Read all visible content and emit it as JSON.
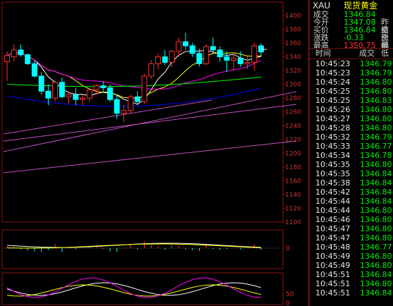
{
  "quote": {
    "symbol": "XAU",
    "name": "现货黄金",
    "rows": [
      {
        "label": "成交",
        "value": "1346.84",
        "color": "#00ee00",
        "extra": ""
      },
      {
        "label": "今开",
        "value": "1347.08",
        "color": "#00ee00",
        "extra": "昨结"
      },
      {
        "label": "买价",
        "value": "1346.84",
        "color": "#00ee00",
        "extra": "卖价"
      },
      {
        "label": "涨跌",
        "value": "-0.33",
        "color": "#00ee00",
        "extra": "涨幅"
      },
      {
        "label": "最高",
        "value": "1350.75",
        "color": "#ff3030",
        "extra": "最低"
      }
    ]
  },
  "ticks": {
    "time_header": "时间",
    "price_header": "成交",
    "rows": [
      {
        "time": "10:45:23",
        "price": "1346.79"
      },
      {
        "time": "10:45:23",
        "price": "1346.79"
      },
      {
        "time": "10:45:24",
        "price": "1346.80"
      },
      {
        "time": "10:45:25",
        "price": "1346.80"
      },
      {
        "time": "10:45:25",
        "price": "1346.83"
      },
      {
        "time": "10:45:26",
        "price": "1346.80"
      },
      {
        "time": "10:45:27",
        "price": "1346.80"
      },
      {
        "time": "10:45:28",
        "price": "1346.80"
      },
      {
        "time": "10:45:32",
        "price": "1346.79"
      },
      {
        "time": "10:45:33",
        "price": "1346.77"
      },
      {
        "time": "10:45:34",
        "price": "1346.78"
      },
      {
        "time": "10:45:35",
        "price": "1346.80"
      },
      {
        "time": "10:45:35",
        "price": "1346.84"
      },
      {
        "time": "10:45:38",
        "price": "1346.84"
      },
      {
        "time": "10:45:42",
        "price": "1346.84"
      },
      {
        "time": "10:45:44",
        "price": "1346.84"
      },
      {
        "time": "10:45:44",
        "price": "1346.80"
      },
      {
        "time": "10:45:46",
        "price": "1346.80"
      },
      {
        "time": "10:45:47",
        "price": "1346.80"
      },
      {
        "time": "10:45:47",
        "price": "1346.80"
      },
      {
        "time": "10:45:48",
        "price": "1346.77"
      },
      {
        "time": "10:45:49",
        "price": "1346.80"
      },
      {
        "time": "10:45:49",
        "price": "1346.80"
      },
      {
        "time": "10:45:51",
        "price": "1346.84"
      },
      {
        "time": "10:45:51",
        "price": "1346.80"
      },
      {
        "time": "10:45:51",
        "price": "1346.84"
      }
    ]
  },
  "price_axis": {
    "labels": [
      "1400",
      "1380",
      "1360",
      "1340",
      "1320",
      "1300",
      "1280",
      "1260",
      "1240",
      "1220",
      "1200",
      "1180",
      "1160",
      "1140",
      "1120",
      "1100"
    ],
    "min": 1100,
    "max": 1400
  },
  "indicator1_axis": {
    "zero_label": "0"
  },
  "indicator2_axis": {
    "labels": [
      "50",
      "0"
    ]
  },
  "colors": {
    "up": "#ff3030",
    "down": "#00ffff",
    "grid_frame": "#8a1515",
    "ma5": "#ffffff",
    "ma10": "#ffff00",
    "ma20": "#ff00ff",
    "ma60": "#00ff00",
    "ma120": "#0000ff",
    "trendline": "#c050c0"
  },
  "chart_data": {
    "type": "candlestick",
    "y_min": 1100,
    "y_max": 1400,
    "candles": [
      {
        "o": 1333,
        "h": 1348,
        "l": 1305,
        "c": 1342
      },
      {
        "o": 1340,
        "h": 1358,
        "l": 1333,
        "c": 1350
      },
      {
        "o": 1350,
        "h": 1358,
        "l": 1340,
        "c": 1343
      },
      {
        "o": 1343,
        "h": 1345,
        "l": 1328,
        "c": 1330
      },
      {
        "o": 1330,
        "h": 1335,
        "l": 1310,
        "c": 1312
      },
      {
        "o": 1312,
        "h": 1318,
        "l": 1285,
        "c": 1290
      },
      {
        "o": 1290,
        "h": 1300,
        "l": 1270,
        "c": 1280
      },
      {
        "o": 1280,
        "h": 1305,
        "l": 1275,
        "c": 1303
      },
      {
        "o": 1303,
        "h": 1310,
        "l": 1280,
        "c": 1282
      },
      {
        "o": 1282,
        "h": 1290,
        "l": 1272,
        "c": 1285
      },
      {
        "o": 1285,
        "h": 1295,
        "l": 1270,
        "c": 1278
      },
      {
        "o": 1278,
        "h": 1285,
        "l": 1270,
        "c": 1280
      },
      {
        "o": 1280,
        "h": 1295,
        "l": 1275,
        "c": 1292
      },
      {
        "o": 1292,
        "h": 1300,
        "l": 1285,
        "c": 1298
      },
      {
        "o": 1298,
        "h": 1305,
        "l": 1288,
        "c": 1295
      },
      {
        "o": 1295,
        "h": 1300,
        "l": 1275,
        "c": 1278
      },
      {
        "o": 1278,
        "h": 1285,
        "l": 1250,
        "c": 1258
      },
      {
        "o": 1258,
        "h": 1270,
        "l": 1245,
        "c": 1262
      },
      {
        "o": 1262,
        "h": 1285,
        "l": 1258,
        "c": 1282
      },
      {
        "o": 1282,
        "h": 1290,
        "l": 1270,
        "c": 1275
      },
      {
        "o": 1275,
        "h": 1315,
        "l": 1272,
        "c": 1312
      },
      {
        "o": 1312,
        "h": 1335,
        "l": 1308,
        "c": 1330
      },
      {
        "o": 1330,
        "h": 1345,
        "l": 1322,
        "c": 1340
      },
      {
        "o": 1340,
        "h": 1350,
        "l": 1328,
        "c": 1332
      },
      {
        "o": 1332,
        "h": 1350,
        "l": 1325,
        "c": 1348
      },
      {
        "o": 1348,
        "h": 1368,
        "l": 1340,
        "c": 1362
      },
      {
        "o": 1362,
        "h": 1375,
        "l": 1350,
        "c": 1356
      },
      {
        "o": 1356,
        "h": 1360,
        "l": 1340,
        "c": 1345
      },
      {
        "o": 1345,
        "h": 1352,
        "l": 1326,
        "c": 1330
      },
      {
        "o": 1330,
        "h": 1358,
        "l": 1328,
        "c": 1355
      },
      {
        "o": 1355,
        "h": 1368,
        "l": 1345,
        "c": 1350
      },
      {
        "o": 1350,
        "h": 1355,
        "l": 1333,
        "c": 1340
      },
      {
        "o": 1340,
        "h": 1348,
        "l": 1318,
        "c": 1335
      },
      {
        "o": 1335,
        "h": 1345,
        "l": 1320,
        "c": 1338
      },
      {
        "o": 1338,
        "h": 1348,
        "l": 1325,
        "c": 1330
      },
      {
        "o": 1330,
        "h": 1340,
        "l": 1322,
        "c": 1332
      },
      {
        "o": 1332,
        "h": 1360,
        "l": 1320,
        "c": 1356
      },
      {
        "o": 1356,
        "h": 1360,
        "l": 1340,
        "c": 1347
      }
    ]
  }
}
